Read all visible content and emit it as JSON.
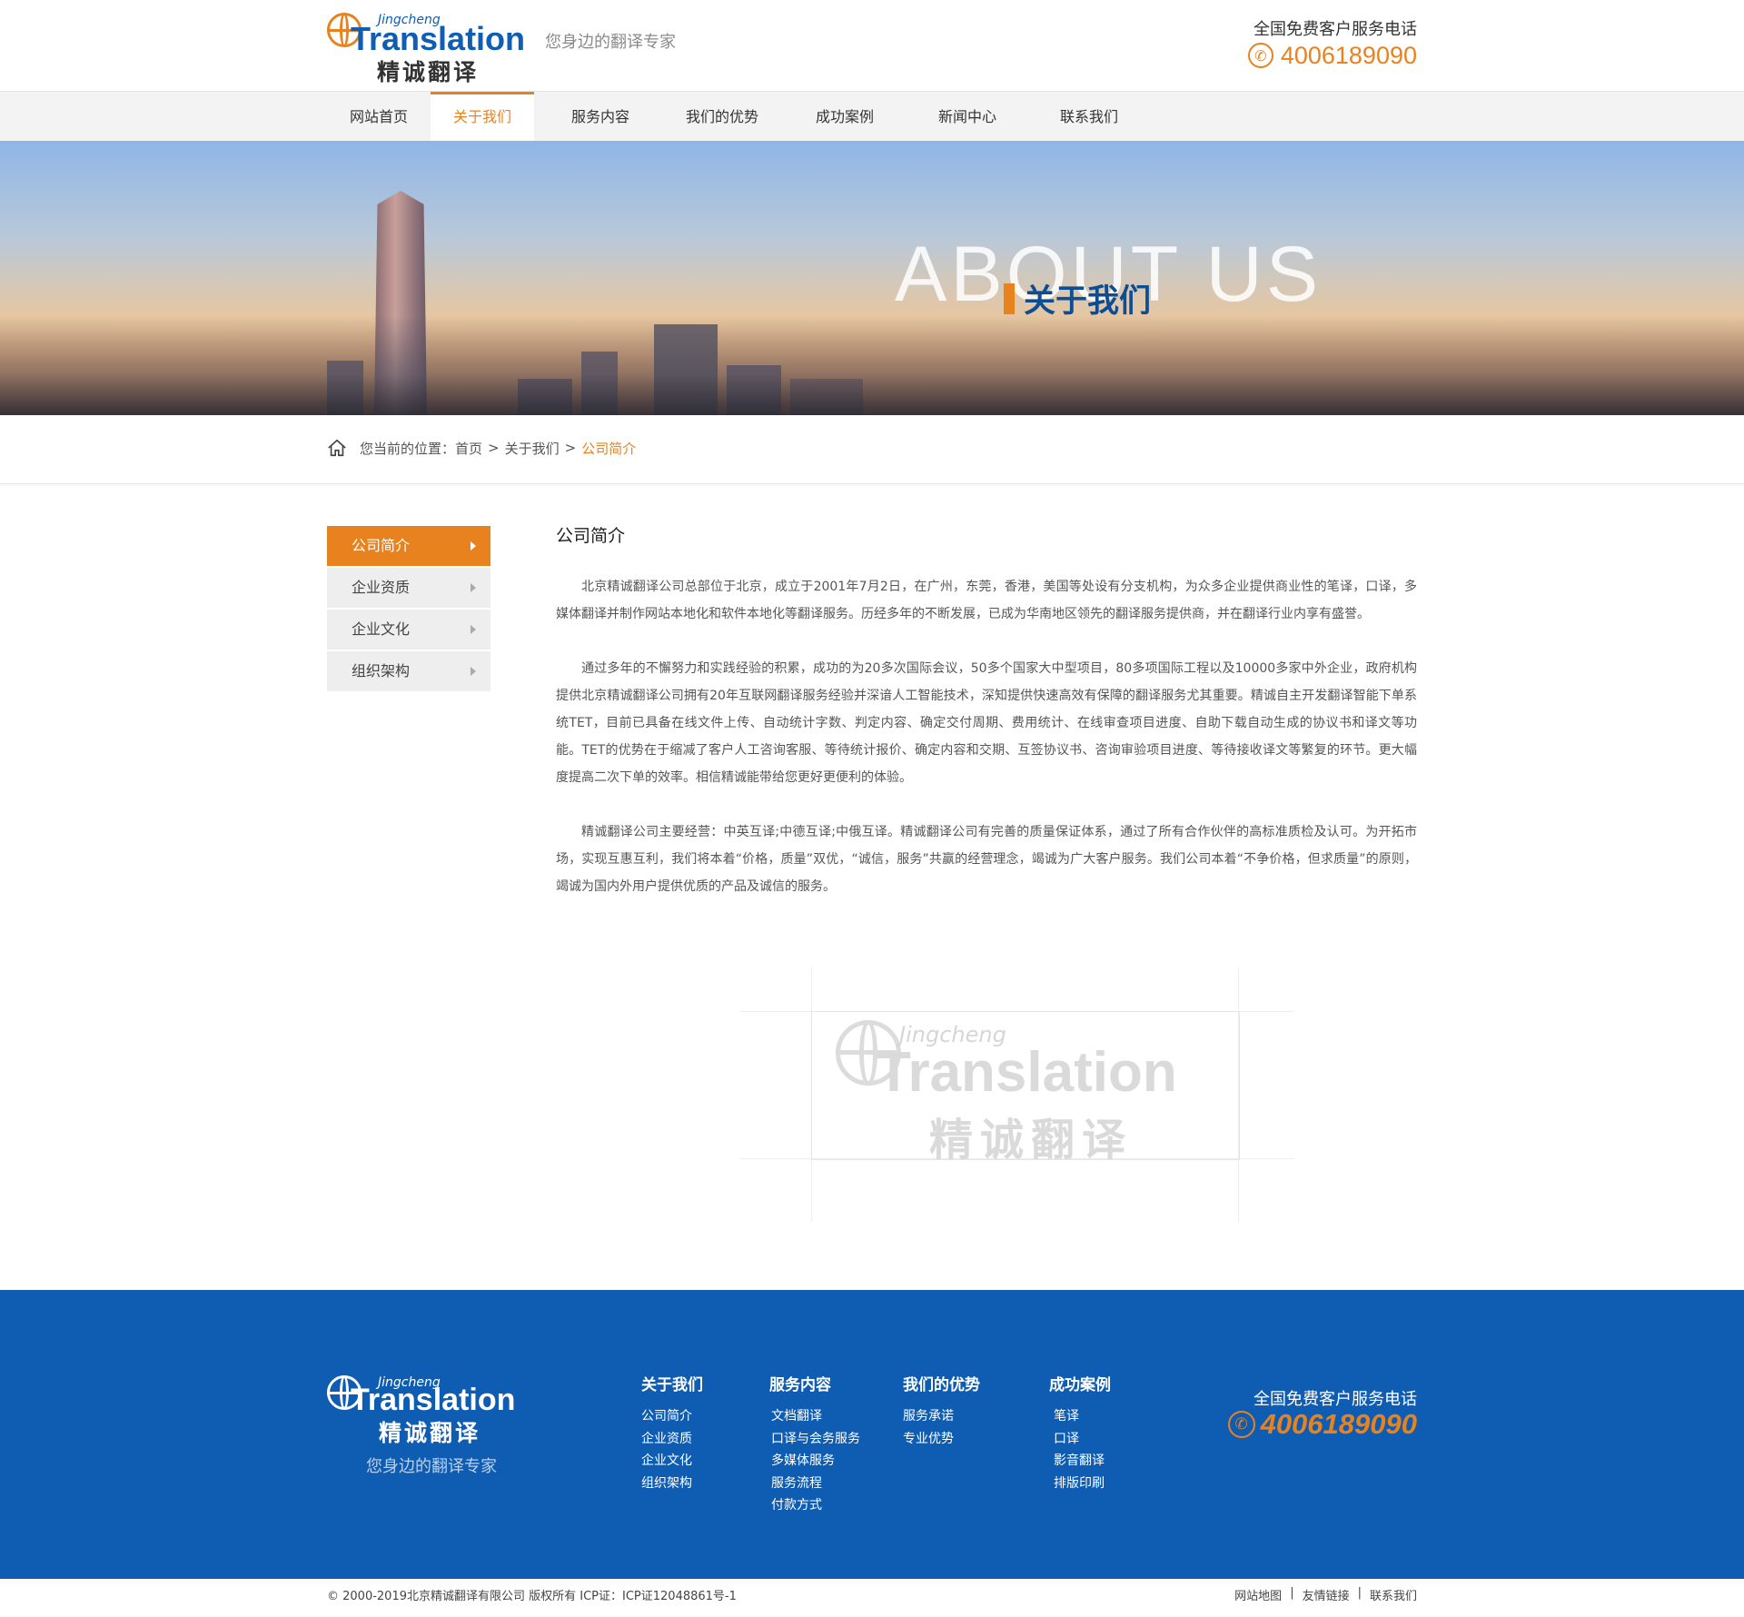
{
  "header": {
    "logo": {
      "en_small": "Jingcheng",
      "en": "Translation",
      "cn": "精诚翻译"
    },
    "slogan": "您身边的翻译专家",
    "hotline_label": "全国免费客户服务电话",
    "hotline_number": "4006189090"
  },
  "nav": {
    "items": [
      {
        "label": "网站首页"
      },
      {
        "label": "关于我们",
        "active": true
      },
      {
        "label": "服务内容"
      },
      {
        "label": "我们的优势"
      },
      {
        "label": "成功案例"
      },
      {
        "label": "新闻中心"
      },
      {
        "label": "联系我们"
      }
    ]
  },
  "banner": {
    "en": "ABOUT US",
    "cn": "关于我们"
  },
  "breadcrumb": {
    "prefix": "您当前的位置：",
    "home": "首页",
    "parent": "关于我们",
    "current": "公司简介",
    "separator": ">"
  },
  "sidebar": {
    "items": [
      {
        "label": "公司简介",
        "active": true
      },
      {
        "label": "企业资质"
      },
      {
        "label": "企业文化"
      },
      {
        "label": "组织架构"
      }
    ]
  },
  "content": {
    "title": "公司简介",
    "paragraphs": [
      "北京精诚翻译公司总部位于北京，成立于2001年7月2日，在广州，东莞，香港，美国等处设有分支机构，为众多企业提供商业性的笔译，口译，多媒体翻译并制作网站本地化和软件本地化等翻译服务。历经多年的不断发展，已成为华南地区领先的翻译服务提供商，并在翻译行业内享有盛誉。",
      "通过多年的不懈努力和实践经验的积累，成功的为20多次国际会议，50多个国家大中型项目，80多项国际工程以及10000多家中外企业，政府机构提供北京精诚翻译公司拥有20年互联网翻译服务经验并深谙人工智能技术，深知提供快速高效有保障的翻译服务尤其重要。精诚自主开发翻译智能下单系统TET，目前已具备在线文件上传、自动统计字数、判定内容、确定交付周期、费用统计、在线审查项目进度、自助下载自动生成的协议书和译文等功能。TET的优势在于缩减了客户人工咨询客服、等待统计报价、确定内容和交期、互签协议书、咨询审验项目进度、等待接收译文等繁复的环节。更大幅度提高二次下单的效率。相信精诚能带给您更好更便利的体验。",
      "精诚翻译公司主要经营：中英互译;中德互译;中俄互译。精诚翻译公司有完善的质量保证体系，通过了所有合作伙伴的高标准质检及认可。为开拓市场，实现互惠互利，我们将本着“价格，质量”双优，“诚信，服务”共赢的经营理念，竭诚为广大客户服务。我们公司本着“不争价格，但求质量”的原则，竭诚为国内外用户提供优质的产品及诚信的服务。"
    ],
    "watermark": {
      "en_small": "Jingcheng",
      "en": "Translation",
      "cn": "精诚翻译"
    }
  },
  "footer": {
    "logo": {
      "en_small": "Jingcheng",
      "en": "Translation",
      "cn": "精诚翻译",
      "slogan": "您身边的翻译专家"
    },
    "columns": [
      {
        "title": "关于我们",
        "links": [
          "公司简介",
          "企业资质",
          "企业文化",
          "组织架构"
        ]
      },
      {
        "title": "服务内容",
        "links": [
          "文档翻译",
          "口译与会务服务",
          "多媒体服务",
          "服务流程",
          "付款方式"
        ]
      },
      {
        "title": "我们的优势",
        "links": [
          "服务承诺",
          "专业优势"
        ]
      },
      {
        "title": "成功案例",
        "links": [
          "笔译",
          "口译",
          "影音翻译",
          "排版印刷"
        ]
      }
    ],
    "hotline_label": "全国免费客户服务电话",
    "hotline_number": "4006189090"
  },
  "copyright": {
    "text": "© 2000-2019北京精诚翻译有限公司 版权所有 ICP证：ICP证12048861号-1",
    "links": [
      "网站地图",
      "友情链接",
      "联系我们"
    ],
    "divider": "|"
  },
  "colors": {
    "accent": "#e8821e",
    "brand_blue": "#0f5db3"
  },
  "icons": {
    "phone": "phone-icon",
    "home": "home-icon",
    "arrow": "chevron-right-icon",
    "globe": "globe-icon"
  }
}
